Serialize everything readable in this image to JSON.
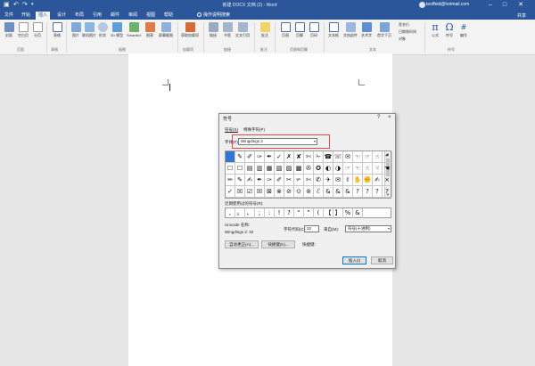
{
  "window": {
    "title": "新建 DOCX 文档 (2) - Word",
    "user": "teoffeid@hotmail.com",
    "share": "共享"
  },
  "quick_access": [
    "save-icon",
    "undo-icon",
    "redo-icon",
    "customize-icon"
  ],
  "tabs": [
    "文件",
    "开始",
    "插入",
    "设计",
    "布局",
    "引用",
    "邮件",
    "审阅",
    "视图",
    "帮助"
  ],
  "active_tab": "插入",
  "tell_me": "操作说明搜索",
  "ribbon": {
    "buttons": [
      "封面",
      "空白页",
      "分页",
      "表格",
      "图片",
      "联机图片",
      "形状",
      "3D 模型",
      "SmartArt",
      "图表",
      "屏幕截图",
      "获取加载项",
      "链接",
      "书签",
      "交叉引用",
      "批注",
      "页眉",
      "页脚",
      "页码",
      "文本框",
      "文档部件",
      "艺术字",
      "首字下沉",
      "公式",
      "符号",
      "编号"
    ],
    "small_items": [
      "签名行",
      "日期和时间",
      "对象"
    ],
    "groups": [
      "页面",
      "表格",
      "插图",
      "加载项",
      "链接",
      "批注",
      "页眉和页脚",
      "文本",
      "符号"
    ]
  },
  "dialog": {
    "title": "符号",
    "help": "?",
    "close": "×",
    "tabs": [
      "符号(S)",
      "特殊字符(P)"
    ],
    "font_label": "字体(F):",
    "font_value": "Wingdings 2",
    "grid_rows": [
      [
        "",
        "✎",
        "✐",
        "✑",
        "✒",
        "✓",
        "✗",
        "✘",
        "✄",
        "✁",
        "☎",
        "☏",
        "✉",
        "☜",
        "☞",
        "☝",
        "❝"
      ],
      [
        "☐",
        "☐",
        "▤",
        "▥",
        "▦",
        "▧",
        "▨",
        "▩",
        "✇",
        "✪",
        "◐",
        "◑",
        "☞",
        "☜",
        "☝",
        "☟",
        "☚"
      ],
      [
        "✏",
        "✎",
        "✍",
        "✒",
        "✑",
        "✐",
        "✂",
        "✃",
        "✄",
        "✆",
        "✈",
        "✉",
        "✌",
        "✋",
        "✊",
        "✍",
        "×"
      ],
      [
        "✓",
        "☒",
        "☑",
        "☒",
        "⊠",
        "⊗",
        "⊘",
        "⊙",
        "⊚",
        "ℰ",
        "&",
        "&",
        "&",
        "?",
        "?",
        "?",
        "?"
      ]
    ],
    "recent_label": "近期使用过的符号(R):",
    "recent": [
      ",",
      "。",
      "、",
      ";",
      ":",
      "!",
      "?",
      "“",
      "”",
      "(",
      "【",
      "】",
      "%",
      "&"
    ],
    "unicode_label": "Unicode 名称:",
    "unicode_value": "Wingdings 2: 32",
    "code_label": "字符代码(C):",
    "code_value": "32",
    "from_label": "来自(M):",
    "from_value": "符号(十进制)",
    "autocorrect": "自动更正(A)...",
    "shortcut_btn": "快捷键(K)...",
    "shortcut_label": "快捷键:",
    "insert": "插入(I)",
    "cancel": "取消"
  }
}
